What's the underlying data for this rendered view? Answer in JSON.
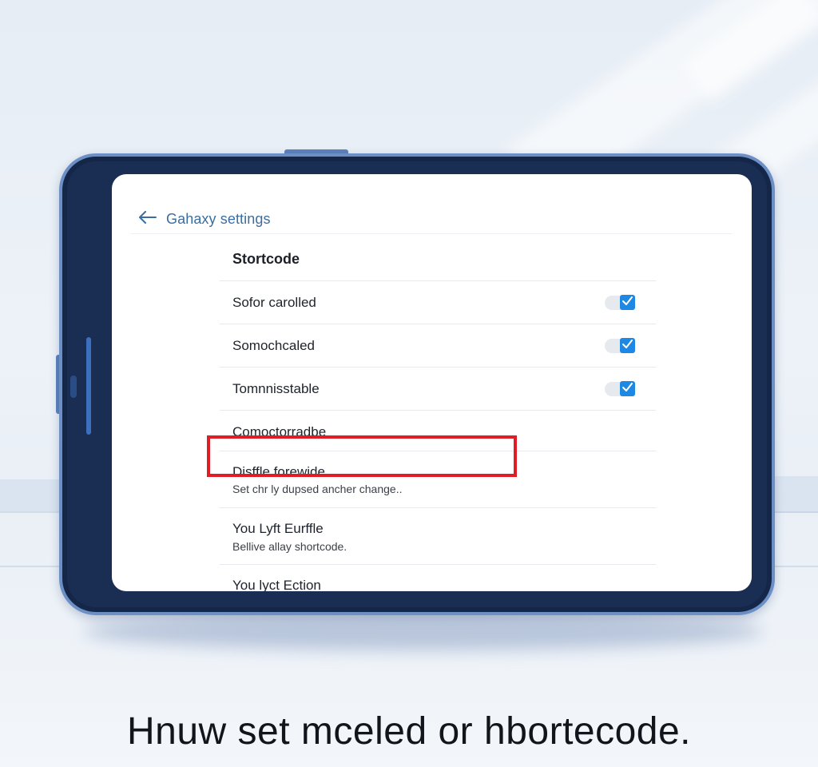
{
  "app": {
    "title": "Gahaxy settings",
    "back_icon": "arrow-left-icon"
  },
  "section": {
    "title": "Stortcode"
  },
  "toggle_items": [
    {
      "label": "Sofor carolled",
      "checked": true
    },
    {
      "label": "Somochcaled",
      "checked": true
    },
    {
      "label": "Tomnnisstable",
      "checked": true
    }
  ],
  "items": [
    {
      "label": "Comoctorradbe"
    },
    {
      "label": "Disffle forewide",
      "subtitle": "Set chr ly dupsed ancher change.."
    },
    {
      "label": "You Lyft Eurffle",
      "subtitle": "Bellive allay shortcode."
    },
    {
      "label": "You lyct Ection"
    }
  ],
  "caption": "Hnuw set mceled or hbortecode.",
  "colors": {
    "accent": "#1e88e5",
    "highlight": "#e01d24",
    "device_frame": "#1a2d52",
    "title_text": "#3a6ea0"
  }
}
